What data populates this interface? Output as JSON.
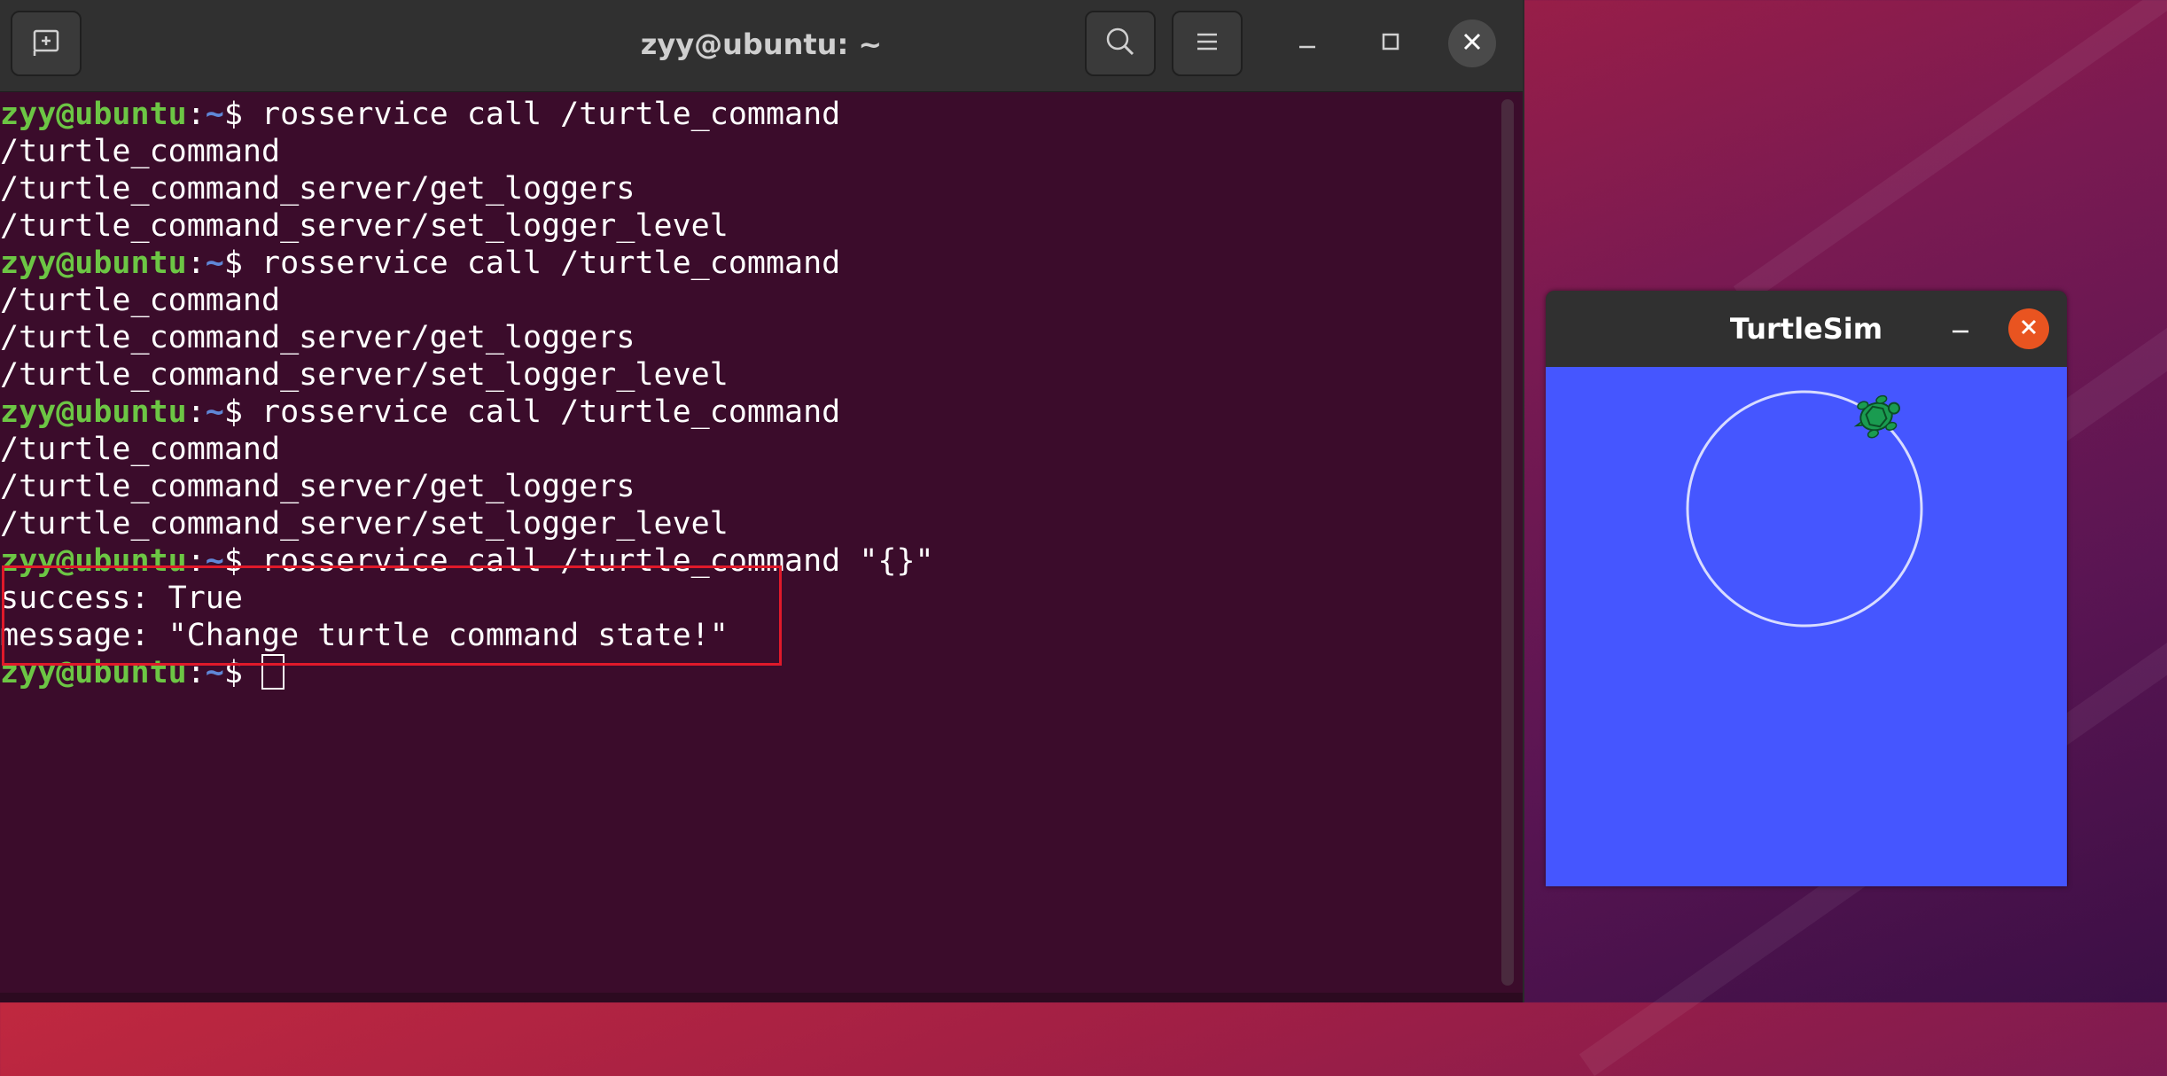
{
  "terminal": {
    "title": "zyy@ubuntu: ~",
    "prompt_user": "zyy@ubuntu",
    "prompt_path": "~",
    "lines": [
      {
        "type": "prompt",
        "cmd": " rosservice call /turtle_command"
      },
      {
        "type": "out",
        "text": "/turtle_command"
      },
      {
        "type": "out",
        "text": "/turtle_command_server/get_loggers"
      },
      {
        "type": "out",
        "text": "/turtle_command_server/set_logger_level"
      },
      {
        "type": "prompt",
        "cmd": " rosservice call /turtle_command"
      },
      {
        "type": "out",
        "text": "/turtle_command"
      },
      {
        "type": "out",
        "text": "/turtle_command_server/get_loggers"
      },
      {
        "type": "out",
        "text": "/turtle_command_server/set_logger_level"
      },
      {
        "type": "prompt",
        "cmd": " rosservice call /turtle_command"
      },
      {
        "type": "out",
        "text": "/turtle_command"
      },
      {
        "type": "out",
        "text": "/turtle_command_server/get_loggers"
      },
      {
        "type": "out",
        "text": "/turtle_command_server/set_logger_level"
      },
      {
        "type": "prompt",
        "cmd": " rosservice call /turtle_command \"{}\""
      },
      {
        "type": "out",
        "text": "success: True"
      },
      {
        "type": "out",
        "text": "message: \"Change turtle command state!\""
      },
      {
        "type": "prompt",
        "cmd": " ",
        "cursor": true
      }
    ]
  },
  "turtlesim": {
    "title": "TurtleSim",
    "background_color": "#4556ff"
  },
  "icons": {
    "new_tab": "new-tab-icon",
    "search": "search-icon",
    "menu": "hamburger-menu-icon",
    "minimize": "minimize-icon",
    "maximize": "maximize-icon",
    "close": "close-icon",
    "turtle": "turtle-icon"
  },
  "colors": {
    "terminal_bg": "#3b0c2b",
    "prompt_user": "#6cc644",
    "prompt_path": "#5f87d7",
    "highlight": "#e0192a",
    "turtlesim_close": "#e95420"
  }
}
